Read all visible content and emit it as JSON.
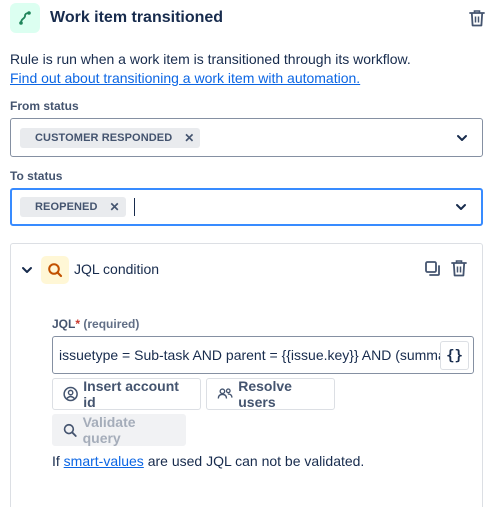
{
  "header": {
    "title": "Work item transitioned",
    "icon": "transition-icon",
    "delete_icon": "trash-icon"
  },
  "description": {
    "text": "Rule is run when a work item is transitioned through its workflow.",
    "link": "Find out about transitioning a work item with automation."
  },
  "from_status": {
    "label": "From status",
    "chips": [
      "CUSTOMER RESPONDED"
    ]
  },
  "to_status": {
    "label": "To status",
    "chips": [
      "REOPENED"
    ]
  },
  "condition": {
    "title": "JQL condition",
    "jql_label": "JQL",
    "required_star": "*",
    "required_text": "(required)",
    "jql_value": "issuetype = Sub-task AND parent = {{issue.key}} AND (summary",
    "smart_values_button": "{}",
    "insert_account_id": "Insert account id",
    "resolve_users": "Resolve users",
    "validate_query": "Validate query",
    "hint_prefix": "If ",
    "hint_link": "smart-values",
    "hint_suffix": " are used JQL can not be validated."
  },
  "colors": {
    "accent": "#0c66e4",
    "trigger_bg": "#dcfff1",
    "condition_bg": "#fff7d6",
    "focus_border": "#388bff"
  }
}
